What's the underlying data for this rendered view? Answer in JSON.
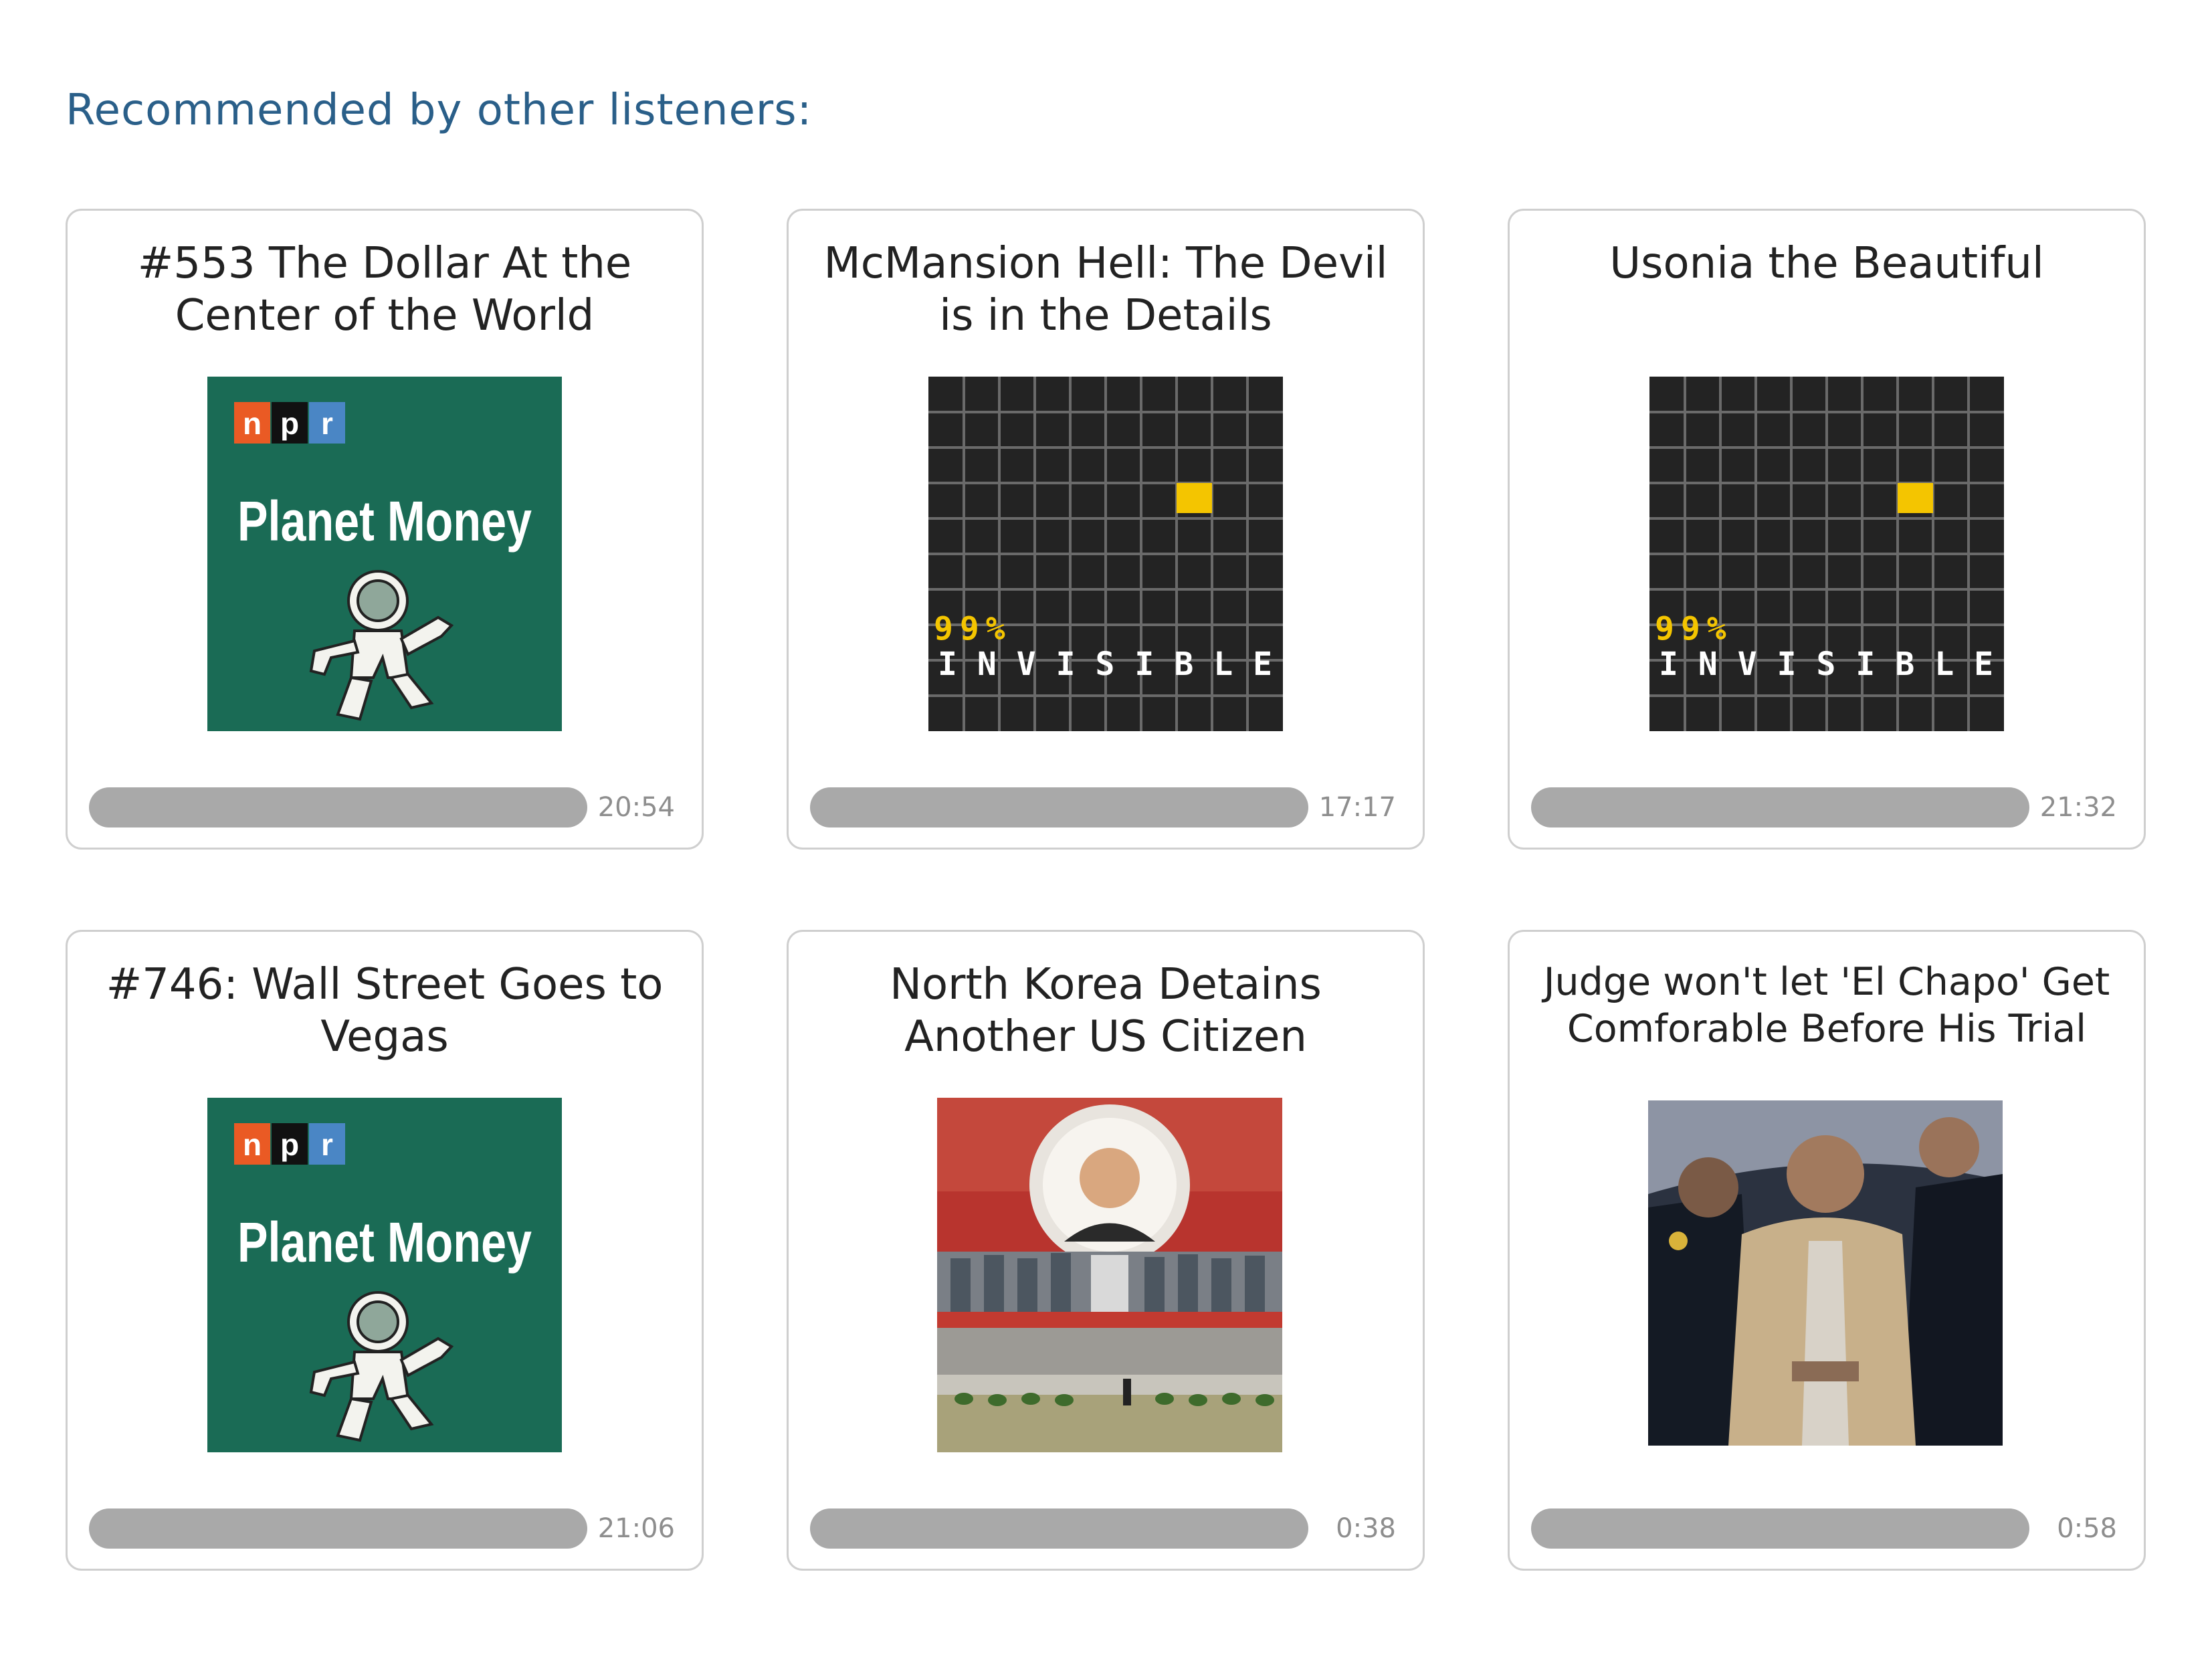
{
  "section": {
    "heading": "Recommended by other listeners:"
  },
  "cards": [
    {
      "title": "#553 The Dollar At the Center of the World",
      "artwork": {
        "type": "planet-money",
        "brand": "npr",
        "brand_letters": [
          "n",
          "p",
          "r"
        ],
        "wordmark": "Planet Money",
        "background": "#1a6b55",
        "brand_colors": [
          "#ea5a24",
          "#111111",
          "#4a86c5"
        ]
      },
      "player": {
        "progress": 0,
        "duration": "20:54"
      }
    },
    {
      "title": "McMansion Hell: The Devil is in the Details",
      "artwork": {
        "type": "99-invisible",
        "percent": "99%",
        "word": "INVISIBLE",
        "accent": "#f4c500",
        "background": "#232323"
      },
      "player": {
        "progress": 0,
        "duration": "17:17"
      }
    },
    {
      "title": "Usonia the Beautiful",
      "artwork": {
        "type": "99-invisible",
        "percent": "99%",
        "word": "INVISIBLE",
        "accent": "#f4c500",
        "background": "#232323"
      },
      "player": {
        "progress": 0,
        "duration": "21:32"
      }
    },
    {
      "title": "#746: Wall Street Goes to Vegas",
      "artwork": {
        "type": "planet-money",
        "brand": "npr",
        "brand_letters": [
          "n",
          "p",
          "r"
        ],
        "wordmark": "Planet Money",
        "background": "#1a6b55",
        "brand_colors": [
          "#ea5a24",
          "#111111",
          "#4a86c5"
        ]
      },
      "player": {
        "progress": 0,
        "duration": "21:06"
      }
    },
    {
      "title": "North Korea Detains Another US Citizen",
      "artwork": {
        "type": "photo",
        "subject": "north-korea-mural-photo"
      },
      "player": {
        "progress": 0,
        "duration": "0:38"
      }
    },
    {
      "title": "Judge won't let 'El Chapo' Get Comforable Before His Trial",
      "artwork": {
        "type": "photo",
        "subject": "el-chapo-escort-photo"
      },
      "player": {
        "progress": 0,
        "duration": "0:58"
      }
    }
  ]
}
